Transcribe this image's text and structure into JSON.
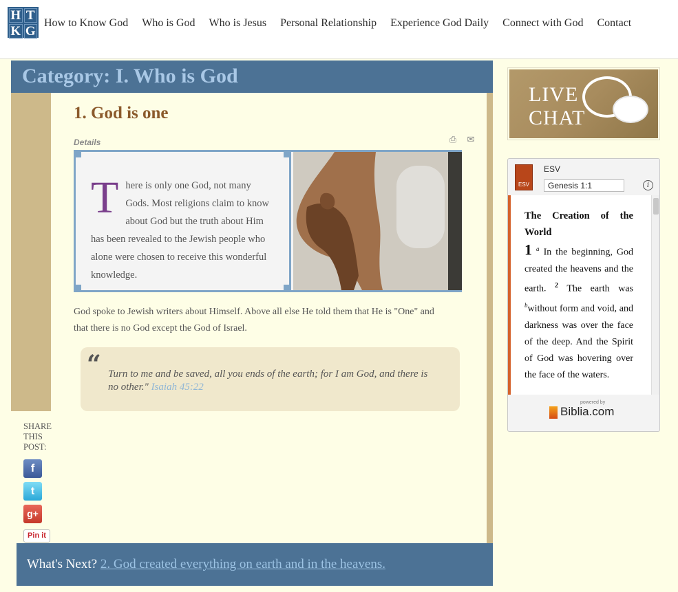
{
  "header": {
    "logo_letters": [
      "H",
      "T",
      "K",
      "G"
    ],
    "nav": [
      "How to Know God",
      "Who is God",
      "Who is Jesus",
      "Personal Relationship",
      "Experience God Daily",
      "Connect with God",
      "Contact"
    ]
  },
  "category": {
    "title": "Category: I. Who is God"
  },
  "post": {
    "title": "1. God is one",
    "details_label": "Details",
    "dropcap": "T",
    "feature_text": "here is only one God, not many Gods. Most religions claim to know about God but the truth about Him has been revealed to the Jewish people who alone were chosen to receive this wonderful knowledge.",
    "body": "God spoke to Jewish writers about Himself. Above all else He told them that He is \"One\" and that there is no God except the God of Israel.",
    "quote_mark": "“",
    "quote": "Turn to me and be saved, all you ends of the earth; for I am God, and there is no other.\"",
    "quote_ref": "Isaiah 45:22"
  },
  "share": {
    "label": "SHARE THIS POST:",
    "facebook": "f",
    "twitter": "t",
    "google": "g+",
    "pinterest": "Pin it"
  },
  "next": {
    "label": "What's Next?",
    "link": "2. God created everything on earth and in the heavens."
  },
  "sidebar": {
    "live_chat_line1": "LIVE",
    "live_chat_line2": "CHAT",
    "biblia": {
      "version": "ESV",
      "icon_label": "ESV",
      "reference": "Genesis 1:1",
      "heading": "The Creation of the World",
      "chapter": "1",
      "fn_a": "a",
      "v1_text": "In the beginning, God created the heavens and the earth.",
      "v2_num": "2",
      "fn_b": "b",
      "v2_text_a": "The earth was",
      "v2_text_b": "without form and void, and darkness was over the face of the deep. And the Spirit of God was hovering over the face of the waters.",
      "powered_by": "powered by",
      "brand": "Biblia.com"
    }
  },
  "colors": {
    "category_bar": "#4c7295",
    "title_brown": "#8b5a2b",
    "tan_strip": "#cdb98a",
    "page_bg": "#fefee6",
    "dropcap": "#7a3f8c"
  }
}
